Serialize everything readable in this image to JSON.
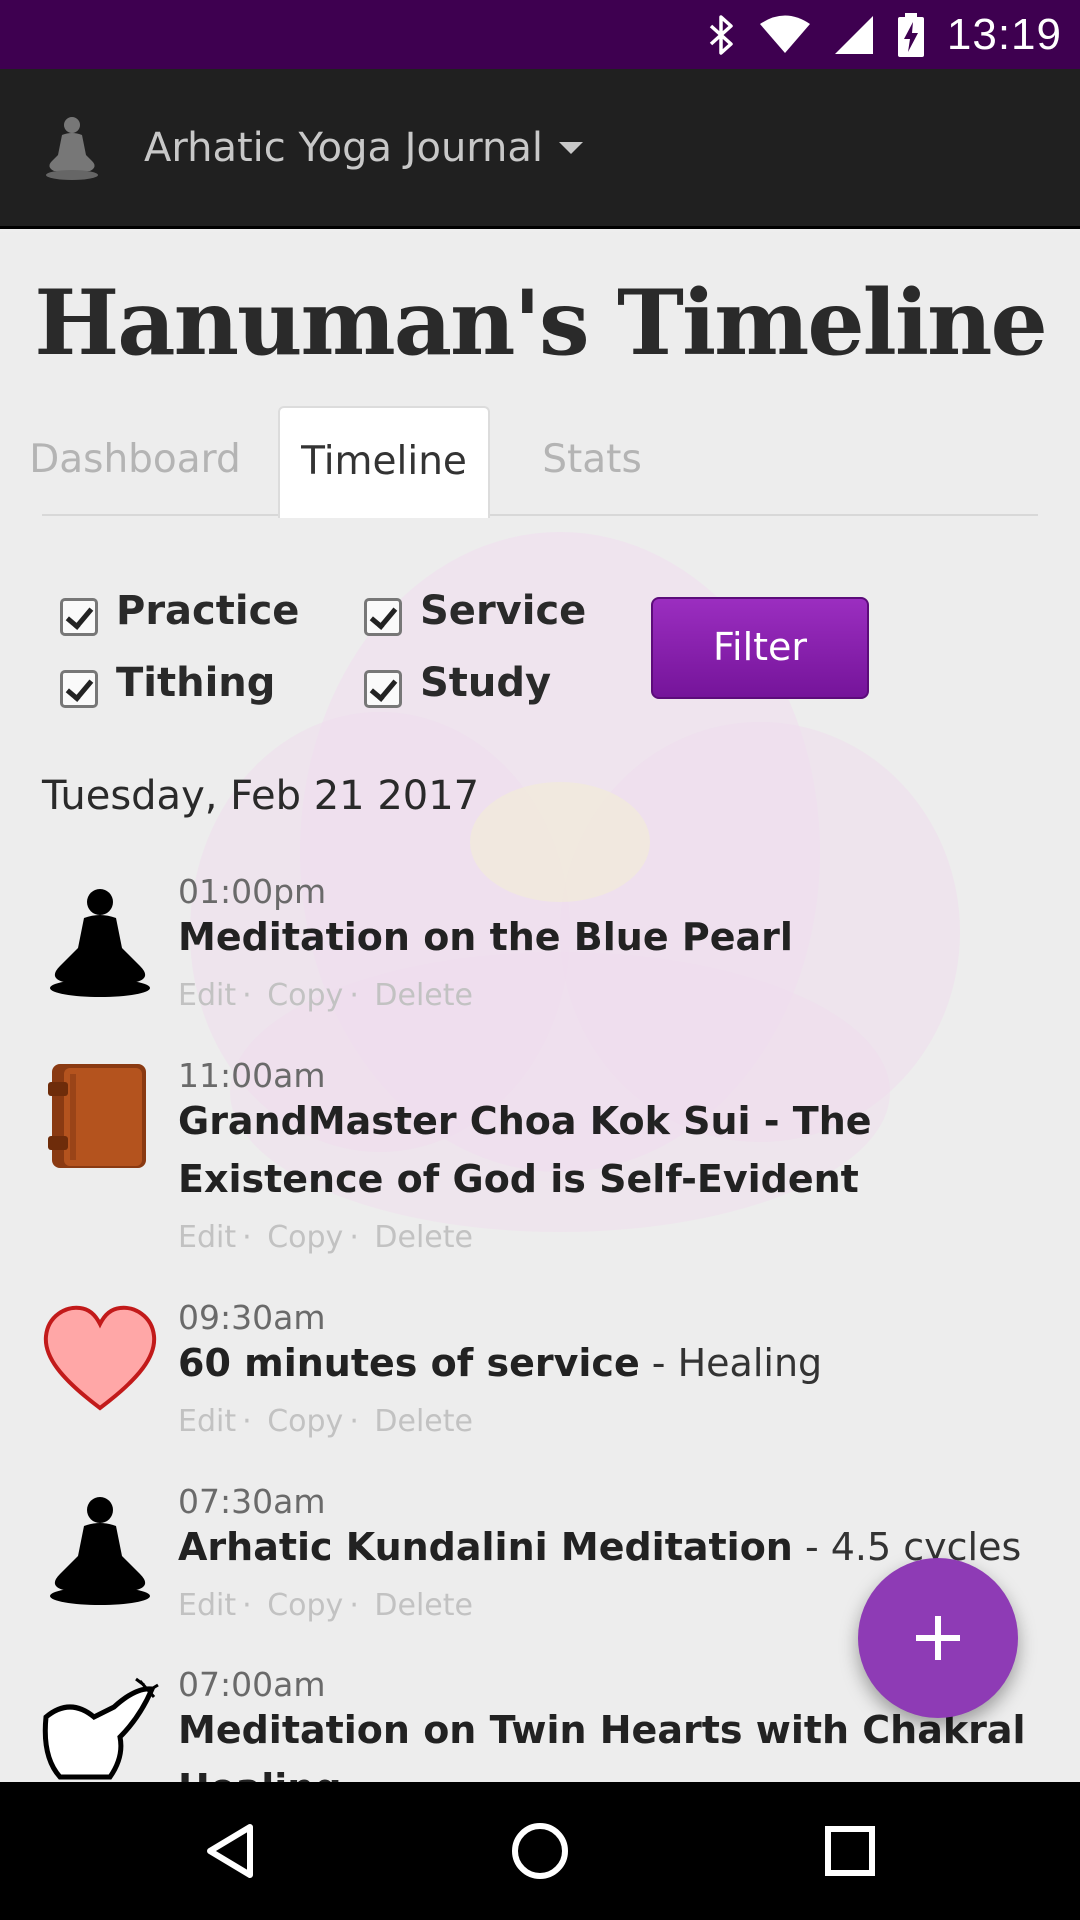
{
  "status_bar": {
    "time": "13:19",
    "icons": [
      "bluetooth-icon",
      "wifi-icon",
      "signal-icon",
      "battery-charging-icon"
    ]
  },
  "toolbar": {
    "app_title": "Arhatic Yoga Journal",
    "logo_icon": "meditation-figure-icon",
    "dropdown_icon": "caret-down-icon"
  },
  "page": {
    "title": "Hanuman's Timeline"
  },
  "tabs": [
    {
      "label": "Dashboard",
      "active": false
    },
    {
      "label": "Timeline",
      "active": true
    },
    {
      "label": "Stats",
      "active": false
    }
  ],
  "filters": {
    "options": [
      {
        "label": "Practice",
        "checked": true
      },
      {
        "label": "Service",
        "checked": true
      },
      {
        "label": "Tithing",
        "checked": true
      },
      {
        "label": "Study",
        "checked": true
      }
    ],
    "button_label": "Filter"
  },
  "timeline": {
    "date": "Tuesday, Feb 21 2017",
    "entries": [
      {
        "time": "01:00pm",
        "title": "Meditation on the Blue Pearl",
        "subtitle": "",
        "icon": "meditation-figure-icon"
      },
      {
        "time": "11:00am",
        "title": "GrandMaster Choa Kok Sui - The Existence of God is Self-Evident",
        "subtitle": "",
        "icon": "book-icon"
      },
      {
        "time": "09:30am",
        "title": "60 minutes of service",
        "subtitle": " - Healing",
        "icon": "heart-icon"
      },
      {
        "time": "07:30am",
        "title": "Arhatic Kundalini Meditation",
        "subtitle": " - 4.5 cycles",
        "icon": "meditation-figure-icon"
      },
      {
        "time": "07:00am",
        "title": "Meditation on Twin Hearts with Chakral Healing",
        "subtitle": "",
        "icon": "dove-icon"
      }
    ],
    "actions": {
      "edit": "Edit",
      "copy": "Copy",
      "delete": "Delete",
      "separator": "·"
    }
  },
  "fab": {
    "icon": "plus-icon",
    "color": "#8e3bb5"
  },
  "nav_bar": {
    "icons": [
      "back-triangle-icon",
      "home-circle-icon",
      "recents-square-icon"
    ]
  },
  "colors": {
    "status_bar": "#3e0050",
    "toolbar": "#202020",
    "accent": "#8a25b0"
  }
}
